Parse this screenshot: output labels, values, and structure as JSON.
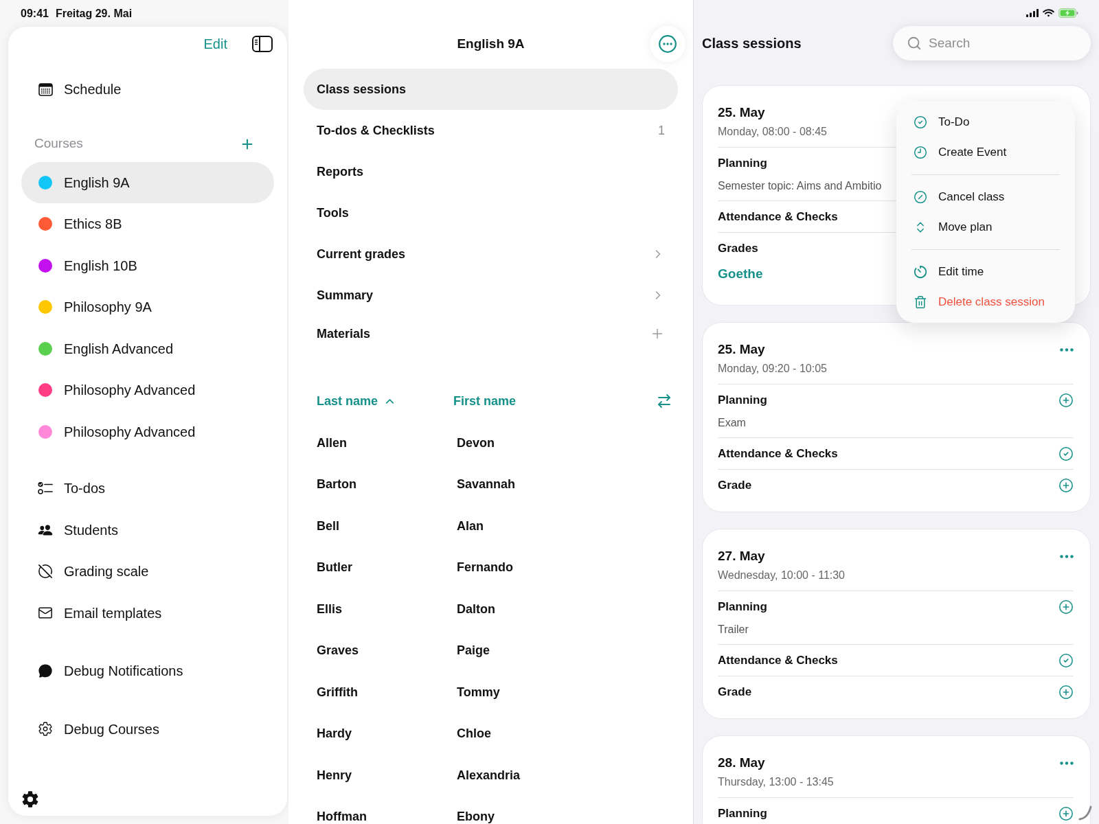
{
  "status_bar": {
    "time": "09:41",
    "date": "Freitag 29. Mai"
  },
  "sidebar": {
    "edit": "Edit",
    "nav": [
      {
        "label": "Schedule"
      }
    ],
    "courses_heading": "Courses",
    "courses": [
      {
        "label": "English 9A",
        "color": "#12c6f7",
        "selected": true
      },
      {
        "label": "Ethics 8B",
        "color": "#ff5a36",
        "selected": false
      },
      {
        "label": "English 10B",
        "color": "#c310ee",
        "selected": false
      },
      {
        "label": "Philosophy 9A",
        "color": "#ffc700",
        "selected": false
      },
      {
        "label": "English Advanced",
        "color": "#5bd04e",
        "selected": false
      },
      {
        "label": "Philosophy Advanced",
        "color": "#ff3b86",
        "selected": false
      },
      {
        "label": "Philosophy Advanced",
        "color": "#ff88d8",
        "selected": false
      }
    ],
    "tools": [
      {
        "label": "To-dos"
      },
      {
        "label": "Students"
      },
      {
        "label": "Grading scale"
      },
      {
        "label": "Email templates"
      }
    ],
    "debug": [
      {
        "label": "Debug Notifications"
      },
      {
        "label": "Debug Courses"
      }
    ]
  },
  "course": {
    "title": "English 9A",
    "sections": [
      {
        "label": "Class sessions",
        "kind": "plain",
        "selected": true
      },
      {
        "label": "To-dos & Checklists",
        "kind": "count",
        "count": "1",
        "selected": false
      },
      {
        "label": "Reports",
        "kind": "plain",
        "selected": false
      },
      {
        "label": "Tools",
        "kind": "plain",
        "selected": false
      },
      {
        "label": "Current grades",
        "kind": "link",
        "selected": false
      },
      {
        "label": "Summary",
        "kind": "link",
        "selected": false
      },
      {
        "label": "Materials",
        "kind": "add",
        "selected": false
      }
    ],
    "students": {
      "columns": [
        {
          "label": "Last name",
          "sorted": true
        },
        {
          "label": "First name",
          "sorted": false
        }
      ],
      "rows": [
        {
          "last_name": "Allen",
          "first_name": "Devon"
        },
        {
          "last_name": "Barton",
          "first_name": "Savannah"
        },
        {
          "last_name": "Bell",
          "first_name": "Alan"
        },
        {
          "last_name": "Butler",
          "first_name": "Fernando"
        },
        {
          "last_name": "Ellis",
          "first_name": "Dalton"
        },
        {
          "last_name": "Graves",
          "first_name": "Paige"
        },
        {
          "last_name": "Griffith",
          "first_name": "Tommy"
        },
        {
          "last_name": "Hardy",
          "first_name": "Chloe"
        },
        {
          "last_name": "Henry",
          "first_name": "Alexandria"
        },
        {
          "last_name": "Hoffman",
          "first_name": "Ebony"
        }
      ]
    }
  },
  "sessions_panel": {
    "title": "Class sessions",
    "search": {
      "placeholder": "Search"
    },
    "sessions": [
      {
        "date": "25. May",
        "time": "Monday, 08:00 - 08:45",
        "more_button": false,
        "sections": [
          {
            "title": "Planning",
            "note": "Semester topic: Aims and Ambitio"
          },
          {
            "title": "Attendance & Checks"
          },
          {
            "title": "Grades",
            "entries": [
              "Goethe"
            ]
          }
        ]
      },
      {
        "date": "25. May",
        "time": "Monday, 09:20 - 10:05",
        "more_button": true,
        "sections": [
          {
            "title": "Planning",
            "note": "Exam",
            "completed": false
          },
          {
            "title": "Attendance & Checks",
            "completed": true
          },
          {
            "title": "Grade",
            "completed": false
          }
        ]
      },
      {
        "date": "27. May",
        "time": "Wednesday, 10:00 - 11:30",
        "more_button": true,
        "sections": [
          {
            "title": "Planning",
            "note": "Trailer",
            "completed": false
          },
          {
            "title": "Attendance & Checks",
            "completed": true
          },
          {
            "title": "Grade",
            "completed": false
          }
        ]
      },
      {
        "date": "28. May",
        "time": "Thursday, 13:00 - 13:45",
        "more_button": true,
        "sections": [
          {
            "title": "Planning",
            "completed": false
          }
        ]
      }
    ],
    "context_menu": {
      "groups": [
        [
          {
            "label": "To-Do",
            "destructive": false
          },
          {
            "label": "Create Event",
            "destructive": false
          }
        ],
        [
          {
            "label": "Cancel class",
            "destructive": false
          },
          {
            "label": "Move plan",
            "destructive": false
          }
        ],
        [
          {
            "label": "Edit time",
            "destructive": false
          },
          {
            "label": "Delete class session",
            "destructive": true
          }
        ]
      ]
    }
  }
}
